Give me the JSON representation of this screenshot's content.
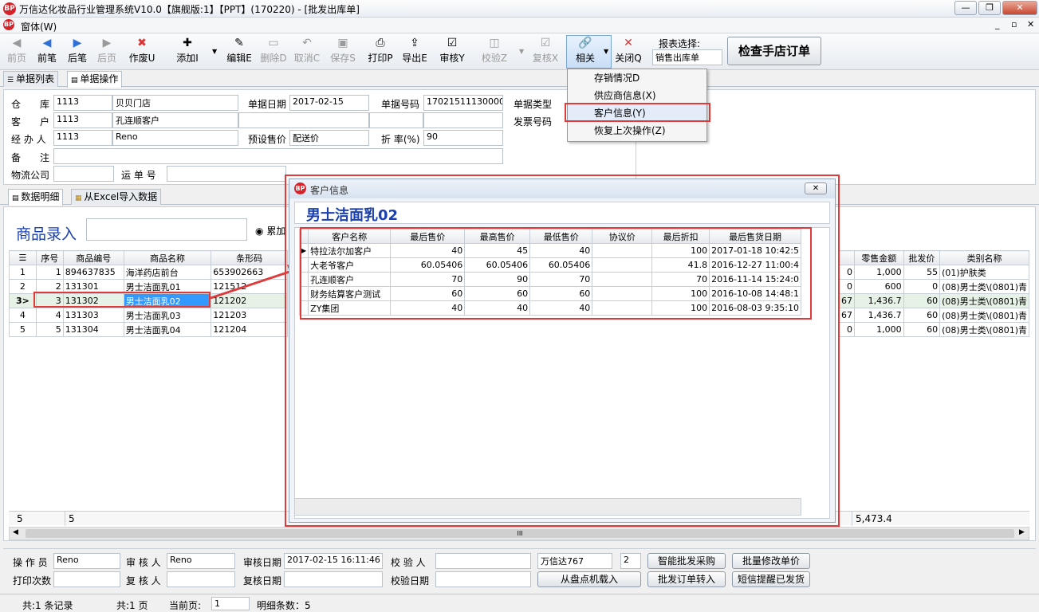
{
  "window": {
    "title": "万信达化妆品行业管理系统V10.0【旗舰版:1】【PPT】(170220) - [批发出库单]",
    "menu": "窗体(W)",
    "child_controls": [
      "_",
      "▫",
      "✕"
    ]
  },
  "toolbar": [
    {
      "label": "前页",
      "icon": "◀",
      "disabled": true
    },
    {
      "label": "前笔",
      "icon": "◀",
      "disabled": false
    },
    {
      "label": "后笔",
      "icon": "▶",
      "disabled": false
    },
    {
      "label": "后页",
      "icon": "▶",
      "disabled": true
    },
    {
      "label": "作废U",
      "icon": "✖",
      "disabled": false
    },
    {
      "label": "添加I",
      "icon": "✚",
      "disabled": false
    },
    {
      "label": "编辑E",
      "icon": "✎",
      "disabled": false
    },
    {
      "label": "删除D",
      "icon": "▭",
      "disabled": true
    },
    {
      "label": "取消C",
      "icon": "↶",
      "disabled": true
    },
    {
      "label": "保存S",
      "icon": "▣",
      "disabled": true
    },
    {
      "label": "打印P",
      "icon": "⎙",
      "disabled": false
    },
    {
      "label": "导出E",
      "icon": "⇪",
      "disabled": false
    },
    {
      "label": "审核Y",
      "icon": "☑",
      "disabled": false
    },
    {
      "label": "校验Z",
      "icon": "◫",
      "disabled": true
    },
    {
      "label": "复核X",
      "icon": "☑",
      "disabled": true
    },
    {
      "label": "相关",
      "icon": "🔗",
      "disabled": false
    },
    {
      "label": "关闭Q",
      "icon": "✕",
      "disabled": false
    }
  ],
  "report": {
    "label": "报表选择:",
    "value": "销售出库单",
    "check_button": "检查手店订单"
  },
  "dropdown_menu": [
    "存销情况D",
    "供应商信息(X)",
    "客户信息(Y)",
    "恢复上次操作(Z)"
  ],
  "main_tabs": [
    "单据列表",
    "单据操作"
  ],
  "form": {
    "warehouse_label": "仓　　库",
    "warehouse_code": "1113",
    "warehouse_name": "贝贝门店",
    "customer_label": "客　　户",
    "customer_code": "1113",
    "customer_name": "孔连顺客户",
    "agent_label": "经 办 人",
    "agent_code": "1113",
    "agent_name": "Reno",
    "remark_label": "备　　注",
    "logistics_label": "物流公司",
    "waybill_label": "运 单 号",
    "date_label": "单据日期",
    "date": "2017-02-15",
    "preset_price_label": "预设售价",
    "preset_price": "配送价",
    "no_label": "单据号码",
    "no": "1702151113000000",
    "discount_label": "折 率(%)",
    "discount": "90",
    "type_label": "单据类型",
    "invoice_label": "发票号码"
  },
  "sub_tabs": [
    "数据明细",
    "从Excel导入数据"
  ],
  "entry": {
    "label": "商品录入",
    "radio": "累加"
  },
  "grid": {
    "headers": [
      "序号",
      "商品编号",
      "商品名称",
      "条形码"
    ],
    "rows": [
      {
        "marker": "1",
        "seq": "1",
        "code": "894637835",
        "name": "海洋药店前台",
        "barcode": "653902663"
      },
      {
        "marker": "2",
        "seq": "2",
        "code": "131301",
        "name": "男士洁面乳01",
        "barcode": "121512"
      },
      {
        "marker": "3>",
        "seq": "3",
        "code": "131302",
        "name": "男士洁面乳02",
        "barcode": "121202"
      },
      {
        "marker": "4",
        "seq": "4",
        "code": "131303",
        "name": "男士洁面乳03",
        "barcode": "121203"
      },
      {
        "marker": "5",
        "seq": "5",
        "code": "131304",
        "name": "男士洁面乳04",
        "barcode": "121204"
      }
    ],
    "right_headers": [
      "零售金额",
      "批发价",
      "类别名称"
    ],
    "right_rows": [
      {
        "a": "0",
        "retail": "1,000",
        "wholesale": "55",
        "category": "(01)护肤类"
      },
      {
        "a": "0",
        "retail": "600",
        "wholesale": "0",
        "category": "(08)男士类\\(0801)青"
      },
      {
        "a": "67",
        "retail": "1,436.7",
        "wholesale": "60",
        "category": "(08)男士类\\(0801)青"
      },
      {
        "a": "67",
        "retail": "1,436.7",
        "wholesale": "60",
        "category": "(08)男士类\\(0801)青"
      },
      {
        "a": "0",
        "retail": "1,000",
        "wholesale": "60",
        "category": "(08)男士类\\(0801)青"
      }
    ],
    "footer_count": "5",
    "footer_seq": "5",
    "footer_total": "5,473.4",
    "scroll_mark": "III"
  },
  "dialog": {
    "title": "客户信息",
    "product": "男士洁面乳02",
    "headers": [
      "客户名称",
      "最后售价",
      "最高售价",
      "最低售价",
      "协议价",
      "最后折扣",
      "最后售货日期"
    ],
    "rows": [
      {
        "name": "特拉法尔加客户",
        "last": "40",
        "max": "45",
        "min": "40",
        "agreed": "",
        "disc": "100",
        "date": "2017-01-18 10:42:5"
      },
      {
        "name": "大老爷客户",
        "last": "60.05406",
        "max": "60.05406",
        "min": "60.05406",
        "agreed": "",
        "disc": "41.8",
        "date": "2016-12-27 11:00:4"
      },
      {
        "name": "孔连顺客户",
        "last": "70",
        "max": "90",
        "min": "70",
        "agreed": "",
        "disc": "70",
        "date": "2016-11-14 15:24:0"
      },
      {
        "name": "财务结算客户测试",
        "last": "60",
        "max": "60",
        "min": "60",
        "agreed": "",
        "disc": "100",
        "date": "2016-10-08 14:48:1"
      },
      {
        "name": "ZY集团",
        "last": "40",
        "max": "40",
        "min": "40",
        "agreed": "",
        "disc": "100",
        "date": "2016-08-03 9:35:10"
      }
    ]
  },
  "bottom": {
    "operator_label": "操 作 员",
    "operator": "Reno",
    "auditor_label": "审 核 人",
    "auditor": "Reno",
    "audit_date_label": "审核日期",
    "audit_date": "2017-02-15 16:11:46",
    "checker_label": "校 验 人",
    "print_label": "打印次数",
    "reviewer_label": "复 核 人",
    "review_date_label": "复核日期",
    "check_date_label": "校验日期",
    "company": "万信达767",
    "company_num": "2",
    "btn_smart": "智能批发采购",
    "btn_batch": "批量修改单价",
    "btn_load": "从盘点机载入",
    "btn_order": "批发订单转入",
    "btn_sms": "短信提醒已发货"
  },
  "status": {
    "records": "共:1 条记录",
    "pages": "共:1 页",
    "current_label": "当前页:",
    "current": "1",
    "detail": "明细条数：5"
  },
  "colors": {
    "highlight": "#e03b3b",
    "selection": "#3399ff",
    "accent": "#1a3fb0"
  }
}
